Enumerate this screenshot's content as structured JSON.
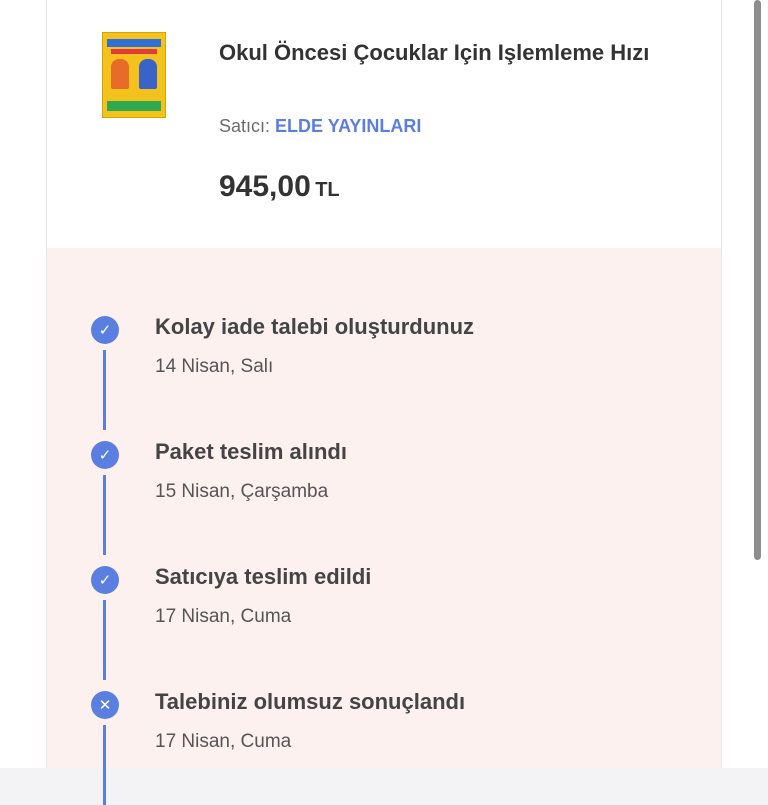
{
  "product": {
    "title": "Okul Öncesi Çocuklar Için Işlemleme Hızı",
    "seller_label": "Satıcı:",
    "seller_name": "ELDE YAYINLARI",
    "price_amount": "945,00",
    "price_currency": "TL"
  },
  "timeline": {
    "accent_color": "#5b7fe0",
    "steps": [
      {
        "title": "Kolay iade talebi oluşturdunuz",
        "date": "14 Nisan, Salı",
        "icon": "check-icon",
        "symbol": "✓"
      },
      {
        "title": "Paket teslim alındı",
        "date": "15 Nisan, Çarşamba",
        "icon": "check-icon",
        "symbol": "✓"
      },
      {
        "title": "Satıcıya teslim edildi",
        "date": "17 Nisan, Cuma",
        "icon": "check-icon",
        "symbol": "✓"
      },
      {
        "title": "Talebiniz olumsuz sonuçlandı",
        "date": "17 Nisan, Cuma",
        "icon": "close-icon",
        "symbol": "✕"
      }
    ]
  }
}
